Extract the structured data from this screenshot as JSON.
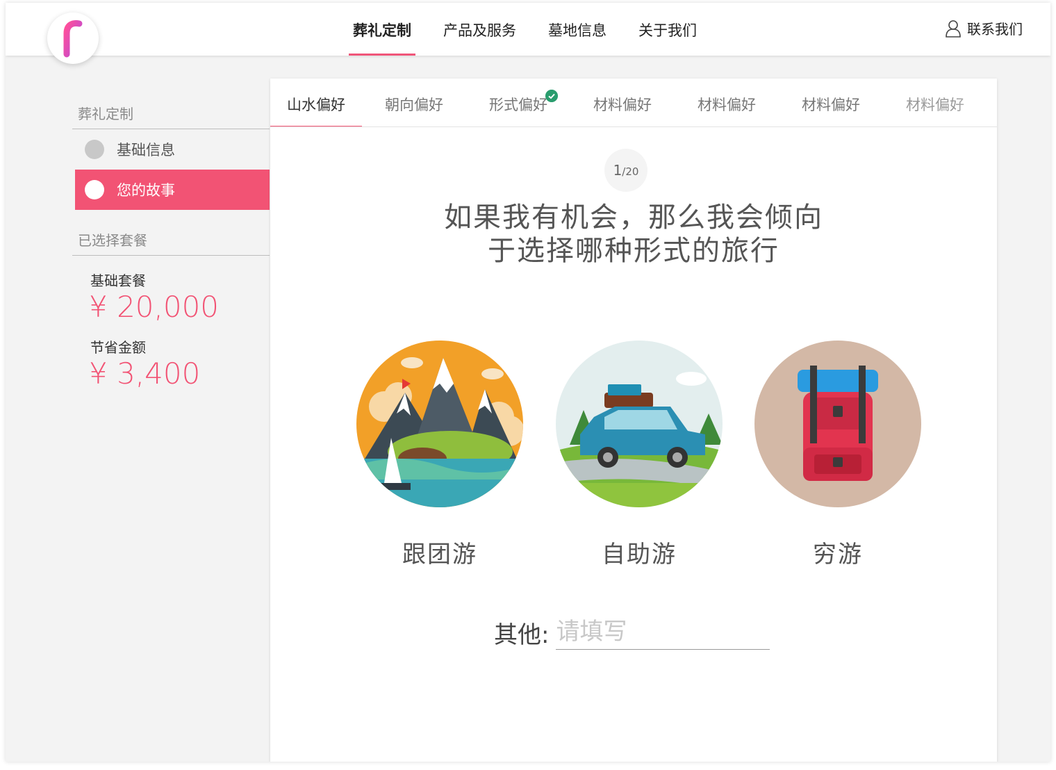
{
  "header": {
    "logo_letter": "f",
    "nav": [
      "葬礼定制",
      "产品及服务",
      "墓地信息",
      "关于我们"
    ],
    "contact": "联系我们"
  },
  "sidebar": {
    "section1_title": "葬礼定制",
    "items": [
      {
        "label": "基础信息"
      },
      {
        "label": "您的故事"
      }
    ],
    "section2_title": "已选择套餐",
    "package_label": "基础套餐",
    "package_price": "¥ 20,000",
    "savings_label": "节省金额",
    "savings_price": "¥ 3,400"
  },
  "tabs": [
    "山水偏好",
    "朝向偏好",
    "形式偏好",
    "材料偏好",
    "材料偏好",
    "材料偏好",
    "材料偏好"
  ],
  "colors": {
    "accent": "#f25374",
    "check": "#2a9d6e"
  },
  "question": {
    "current": "1",
    "total": "/20",
    "line1": "如果我有机会，那么我会倾向",
    "line2": "于选择哪种形式的旅行"
  },
  "options": [
    {
      "label": "跟团游",
      "icon": "mountain-lake-illustration"
    },
    {
      "label": "自助游",
      "icon": "car-road-trip-illustration"
    },
    {
      "label": "穷游",
      "icon": "backpack-illustration"
    }
  ],
  "other": {
    "label": "其他:",
    "placeholder": "请填写"
  }
}
